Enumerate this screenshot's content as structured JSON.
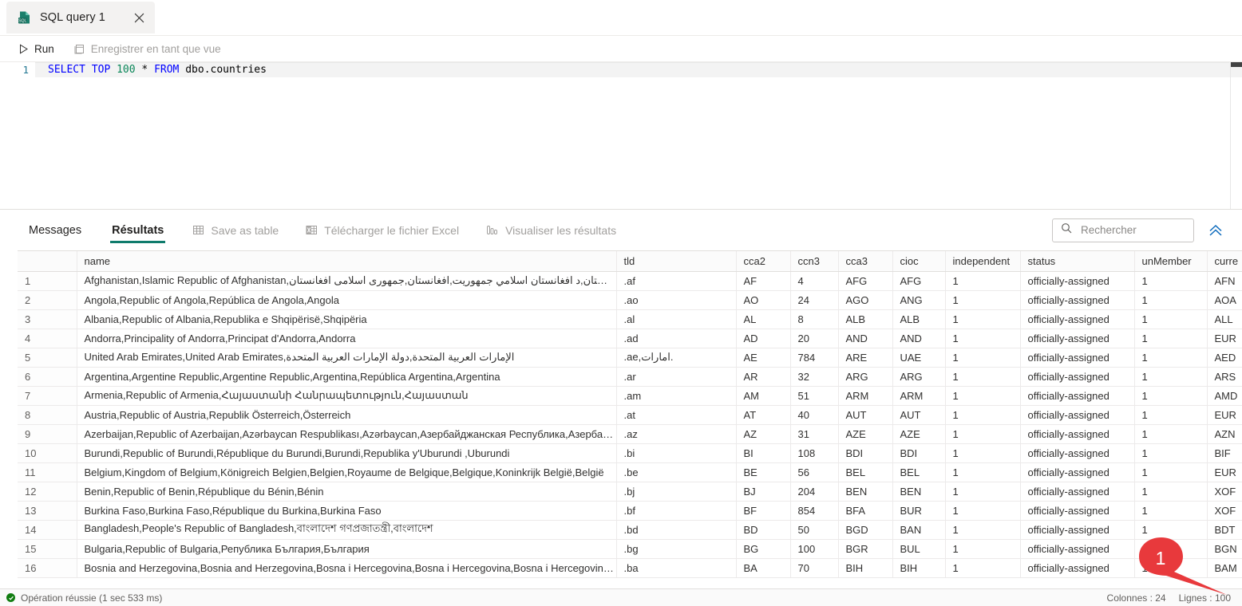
{
  "tab": {
    "title": "SQL query 1",
    "icon": "sql-file-icon",
    "close_icon": "close-icon"
  },
  "toolbar": {
    "run_label": "Run",
    "run_icon": "play-icon",
    "save_view_label": "Enregistrer en tant que vue",
    "save_view_icon": "save-view-icon"
  },
  "editor": {
    "line_number": "1",
    "tokens": {
      "select": "SELECT",
      "top": "TOP",
      "limit": "100",
      "star": "*",
      "from": "FROM",
      "table": "dbo.countries"
    }
  },
  "results_toolbar": {
    "tab_messages": "Messages",
    "tab_results": "Résultats",
    "save_as_table": "Save as table",
    "save_as_table_icon": "table-grid-icon",
    "download_excel": "Télécharger le fichier Excel",
    "download_excel_icon": "excel-icon",
    "visualize": "Visualiser les résultats",
    "visualize_icon": "chart-icon",
    "search_placeholder": "Rechercher",
    "search_value": "",
    "search_icon": "search-icon",
    "collapse_icon": "double-chevron-up-icon"
  },
  "grid": {
    "columns": [
      "name",
      "tld",
      "cca2",
      "ccn3",
      "cca3",
      "cioc",
      "independent",
      "status",
      "unMember",
      "curre"
    ],
    "rows": [
      {
        "n": "1",
        "name": "Afghanistan,Islamic Republic of Afghanistan,افغانستان,افغانستان,د افغانستان اسلامي جمهوريت,افغانستان,جمهوری اسلامی افغانستان,Ow…",
        "tld": ".af",
        "cca2": "AF",
        "ccn3": "4",
        "cca3": "AFG",
        "cioc": "AFG",
        "independent": "1",
        "status": "officially-assigned",
        "unMember": "1",
        "curre": "AFN"
      },
      {
        "n": "2",
        "name": "Angola,Republic of Angola,República de Angola,Angola",
        "tld": ".ao",
        "cca2": "AO",
        "ccn3": "24",
        "cca3": "AGO",
        "cioc": "ANG",
        "independent": "1",
        "status": "officially-assigned",
        "unMember": "1",
        "curre": "AOA"
      },
      {
        "n": "3",
        "name": "Albania,Republic of Albania,Republika e Shqipërisë,Shqipëria",
        "tld": ".al",
        "cca2": "AL",
        "ccn3": "8",
        "cca3": "ALB",
        "cioc": "ALB",
        "independent": "1",
        "status": "officially-assigned",
        "unMember": "1",
        "curre": "ALL"
      },
      {
        "n": "4",
        "name": "Andorra,Principality of Andorra,Principat d'Andorra,Andorra",
        "tld": ".ad",
        "cca2": "AD",
        "ccn3": "20",
        "cca3": "AND",
        "cioc": "AND",
        "independent": "1",
        "status": "officially-assigned",
        "unMember": "1",
        "curre": "EUR"
      },
      {
        "n": "5",
        "name": "United Arab Emirates,United Arab Emirates,الإمارات العربية المتحدة,دولة الإمارات العربية المتحدة",
        "tld": ".ae,امارات.",
        "cca2": "AE",
        "ccn3": "784",
        "cca3": "ARE",
        "cioc": "UAE",
        "independent": "1",
        "status": "officially-assigned",
        "unMember": "1",
        "curre": "AED"
      },
      {
        "n": "6",
        "name": "Argentina,Argentine Republic,Argentine Republic,Argentina,República Argentina,Argentina",
        "tld": ".ar",
        "cca2": "AR",
        "ccn3": "32",
        "cca3": "ARG",
        "cioc": "ARG",
        "independent": "1",
        "status": "officially-assigned",
        "unMember": "1",
        "curre": "ARS"
      },
      {
        "n": "7",
        "name": "Armenia,Republic of Armenia,Հայաստանի Հանրապետություն,Հայաստան",
        "tld": ".am",
        "cca2": "AM",
        "ccn3": "51",
        "cca3": "ARM",
        "cioc": "ARM",
        "independent": "1",
        "status": "officially-assigned",
        "unMember": "1",
        "curre": "AMD"
      },
      {
        "n": "8",
        "name": "Austria,Republic of Austria,Republik Österreich,Österreich",
        "tld": ".at",
        "cca2": "AT",
        "ccn3": "40",
        "cca3": "AUT",
        "cioc": "AUT",
        "independent": "1",
        "status": "officially-assigned",
        "unMember": "1",
        "curre": "EUR"
      },
      {
        "n": "9",
        "name": "Azerbaijan,Republic of Azerbaijan,Azərbaycan Respublikası,Azərbaycan,Азербайджанская Республика,Азербайджан",
        "tld": ".az",
        "cca2": "AZ",
        "ccn3": "31",
        "cca3": "AZE",
        "cioc": "AZE",
        "independent": "1",
        "status": "officially-assigned",
        "unMember": "1",
        "curre": "AZN"
      },
      {
        "n": "10",
        "name": "Burundi,Republic of Burundi,République du Burundi,Burundi,Republika y'Uburundi ,Uburundi",
        "tld": ".bi",
        "cca2": "BI",
        "ccn3": "108",
        "cca3": "BDI",
        "cioc": "BDI",
        "independent": "1",
        "status": "officially-assigned",
        "unMember": "1",
        "curre": "BIF"
      },
      {
        "n": "11",
        "name": "Belgium,Kingdom of Belgium,Königreich Belgien,Belgien,Royaume de Belgique,Belgique,Koninkrijk België,België",
        "tld": ".be",
        "cca2": "BE",
        "ccn3": "56",
        "cca3": "BEL",
        "cioc": "BEL",
        "independent": "1",
        "status": "officially-assigned",
        "unMember": "1",
        "curre": "EUR"
      },
      {
        "n": "12",
        "name": "Benin,Republic of Benin,République du Bénin,Bénin",
        "tld": ".bj",
        "cca2": "BJ",
        "ccn3": "204",
        "cca3": "BEN",
        "cioc": "BEN",
        "independent": "1",
        "status": "officially-assigned",
        "unMember": "1",
        "curre": "XOF"
      },
      {
        "n": "13",
        "name": "Burkina Faso,Burkina Faso,République du Burkina,Burkina Faso",
        "tld": ".bf",
        "cca2": "BF",
        "ccn3": "854",
        "cca3": "BFA",
        "cioc": "BUR",
        "independent": "1",
        "status": "officially-assigned",
        "unMember": "1",
        "curre": "XOF"
      },
      {
        "n": "14",
        "name": "Bangladesh,People's Republic of Bangladesh,বাংলাদেশ গণপ্রজাতন্ত্রী,বাংলাদেশ",
        "tld": ".bd",
        "cca2": "BD",
        "ccn3": "50",
        "cca3": "BGD",
        "cioc": "BAN",
        "independent": "1",
        "status": "officially-assigned",
        "unMember": "1",
        "curre": "BDT"
      },
      {
        "n": "15",
        "name": "Bulgaria,Republic of Bulgaria,Република България,България",
        "tld": ".bg",
        "cca2": "BG",
        "ccn3": "100",
        "cca3": "BGR",
        "cioc": "BUL",
        "independent": "1",
        "status": "officially-assigned",
        "unMember": "1",
        "curre": "BGN"
      },
      {
        "n": "16",
        "name": "Bosnia and Herzegovina,Bosnia and Herzegovina,Bosna i Hercegovina,Bosna i Hercegovina,Bosna i Hercegovina,Bosna i H…",
        "tld": ".ba",
        "cca2": "BA",
        "ccn3": "70",
        "cca3": "BIH",
        "cioc": "BIH",
        "independent": "1",
        "status": "officially-assigned",
        "unMember": "1",
        "curre": "BAM"
      }
    ]
  },
  "statusbar": {
    "status_text": "Opération réussie (1 sec 533 ms)",
    "status_icon": "success-check-icon",
    "columns_text": "Colonnes : 24",
    "rows_text": "Lignes : 100"
  },
  "annotation": {
    "pin_label": "1",
    "pin_color": "#e8393c"
  }
}
